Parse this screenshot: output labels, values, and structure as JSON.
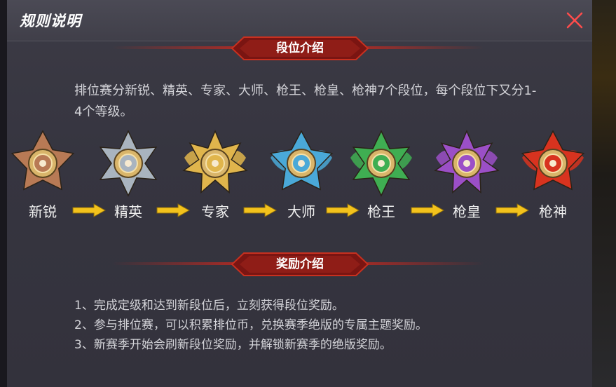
{
  "header": {
    "title": "规则说明",
    "close_icon": "close-icon"
  },
  "section_rank": {
    "title": "段位介绍"
  },
  "intro": {
    "text": "排位赛分新锐、精英、专家、大师、枪王、枪皇、枪神7个段位，每个段位下又分1-4个等级。"
  },
  "ranks": [
    {
      "label": "新锐",
      "color": "#b87a55"
    },
    {
      "label": "精英",
      "color": "#a9b4bf"
    },
    {
      "label": "专家",
      "color": "#e0b54c"
    },
    {
      "label": "大师",
      "color": "#4aa9d8"
    },
    {
      "label": "枪王",
      "color": "#3fae52"
    },
    {
      "label": "枪皇",
      "color": "#9b4fc7"
    },
    {
      "label": "枪神",
      "color": "#d8331f"
    }
  ],
  "arrow_color": "#f3c21c",
  "section_reward": {
    "title": "奖励介绍"
  },
  "rewards": [
    "1、完成定级和达到新段位后，立刻获得段位奖励。",
    "2、参与排位赛，可以积累排位币，兑换赛季绝版的专属主题奖励。",
    "3、新赛季开始会刷新段位奖励，并解锁新赛季的绝版奖励。"
  ]
}
